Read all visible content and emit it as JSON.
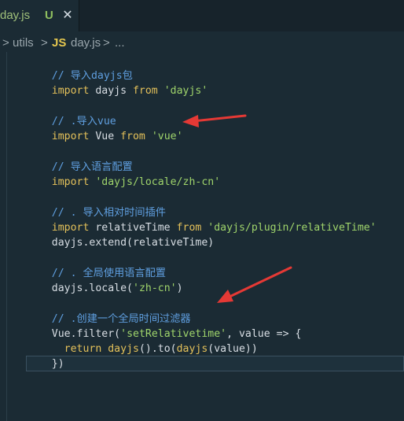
{
  "tab": {
    "title": "day.js",
    "badge": "U",
    "close_glyph": "✕"
  },
  "breadcrumb": {
    "sep": ">",
    "folder": "utils",
    "file_icon": "JS",
    "file": "day.js",
    "ellipsis": "..."
  },
  "code": {
    "l1_comment": "// 导入dayjs包",
    "l2_import": "import",
    "l2_ident": " dayjs ",
    "l2_from": "from",
    "l2_str": " 'dayjs'",
    "l4_comment": "// .导入vue",
    "l5_import": "import",
    "l5_ident": " Vue ",
    "l5_from": "from",
    "l5_str": " 'vue'",
    "l7_comment": "// 导入语言配置",
    "l8_import": "import",
    "l8_str": " 'dayjs/locale/zh-cn'",
    "l10_comment": "// . 导入相对时间插件",
    "l11_import": "import",
    "l11_ident": " relativeTime ",
    "l11_from": "from",
    "l11_str": " 'dayjs/plugin/relativeTime'",
    "l12_obj": "dayjs",
    "l12_method": ".extend(",
    "l12_arg": "relativeTime",
    "l12_close": ")",
    "l14_comment": "// . 全局使用语言配置",
    "l15_obj": "dayjs",
    "l15_method": ".locale(",
    "l15_str": "'zh-cn'",
    "l15_close": ")",
    "l17_comment": "// .创建一个全局时间过滤器",
    "l18_obj": "Vue",
    "l18_method": ".filter(",
    "l18_str": "'setRelativetime'",
    "l18_rest": ", value => {",
    "l19_return": "  return ",
    "l19_call": "dayjs",
    "l19_mid": "().to(",
    "l19_call2": "dayjs",
    "l19_end": "(value))",
    "l20_close": "})"
  },
  "colors": {
    "comment": "#5f9fe0",
    "keyword": "#e4c15a",
    "string": "#9fd46b",
    "arrow": "#e53935"
  }
}
